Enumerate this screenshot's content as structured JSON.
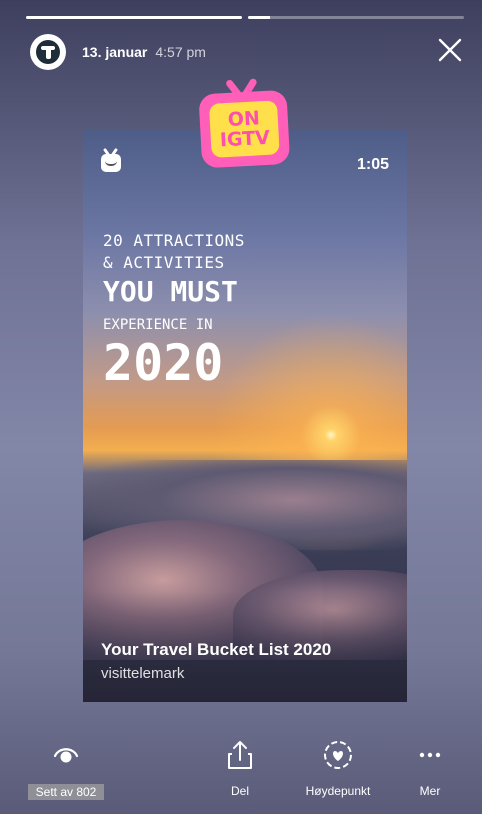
{
  "story": {
    "progress": [
      1.0,
      0.1
    ],
    "date": "13. januar",
    "time": "4:57 pm"
  },
  "sticker": {
    "line1": "ON",
    "line2": "IGTV"
  },
  "video": {
    "duration": "1:05",
    "headline": [
      "20 ATTRACTIONS",
      "& ACTIVITIES",
      "YOU MUST",
      "EXPERIENCE IN",
      "2020"
    ],
    "title": "Your Travel Bucket List 2020",
    "account": "visittelemark"
  },
  "bottom_bar": {
    "seen_label": "Sett av 802",
    "share_label": "Del",
    "highlight_label": "Høydepunkt",
    "more_label": "Mer"
  },
  "icons": [
    "avatar-icon",
    "close-icon",
    "igtv-icon",
    "eye-icon",
    "share-icon",
    "highlight-heart-icon",
    "more-icon"
  ]
}
